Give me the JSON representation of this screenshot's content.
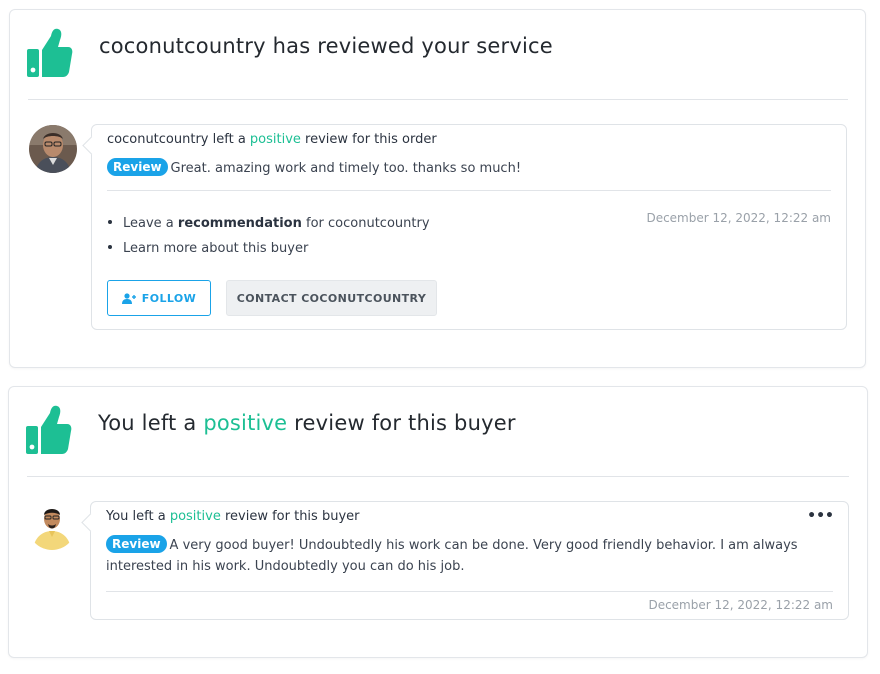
{
  "colors": {
    "accent_green": "#1dbf94",
    "badge_blue": "#1aa3e8",
    "muted_text": "#9aa1a9"
  },
  "notification_1": {
    "icon": "thumbs-up-icon",
    "title": "coconutcountry has reviewed your service",
    "message": {
      "prefix": "coconutcountry left a ",
      "highlight": "positive",
      "suffix": " review for this order"
    },
    "review": {
      "badge": "Review",
      "text": "Great. amazing work and timely too. thanks so much!"
    },
    "links": {
      "item1_prefix": "Leave a ",
      "item1_bold": "recommendation",
      "item1_suffix": " for coconutcountry",
      "item2": "Learn more about this buyer"
    },
    "date": "December 12, 2022, 12:22 am",
    "buttons": {
      "follow": "FOLLOW",
      "contact": "CONTACT COCONUTCOUNTRY"
    }
  },
  "notification_2": {
    "icon": "thumbs-up-icon",
    "title": {
      "prefix": "You left a ",
      "highlight": "positive",
      "suffix": " review for this buyer"
    },
    "message": {
      "prefix": "You left a ",
      "highlight": "positive",
      "suffix": " review for this buyer"
    },
    "review": {
      "badge": "Review",
      "text": "A very good buyer! Undoubtedly his work can be done. Very good friendly behavior. I am always interested in his work. Undoubtedly you can do his job."
    },
    "date": "December 12, 2022, 12:22 am",
    "more_menu": "•••"
  }
}
